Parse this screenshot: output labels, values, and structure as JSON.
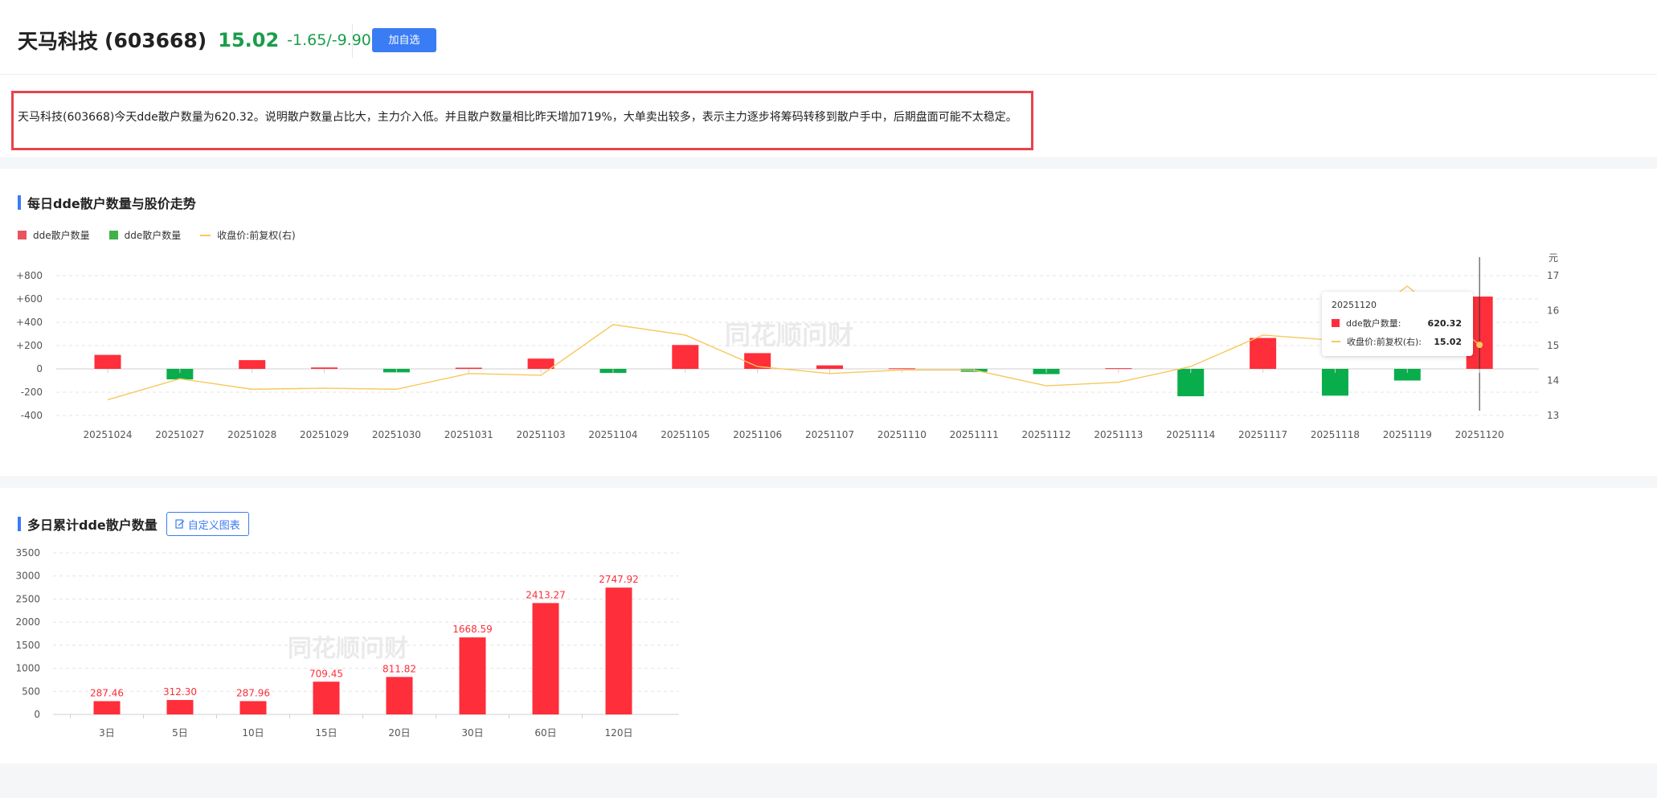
{
  "header": {
    "name": "天马科技",
    "code": "(603668)",
    "price": "15.02",
    "change": "-1.65/-9.90%",
    "add_label": "加自选"
  },
  "summary": {
    "text": "天马科技(603668)今天dde散户数量为620.32。说明散户数量占比大，主力介入低。并且散户数量相比昨天增加719%，大单卖出较多，表示主力逐步将筹码转移到散户手中，后期盘面可能不太稳定。"
  },
  "section1": {
    "title": "每日dde散户数量与股价走势",
    "legend": [
      "dde散户数量",
      "dde散户数量",
      "收盘价:前复权(右)"
    ],
    "unit_right": "元",
    "watermark": "同花顺问财"
  },
  "tooltip": {
    "date": "20251120",
    "label1": "dde散户数量:",
    "value1": "620.32",
    "label2": "收盘价:前复权(右):",
    "value2": "15.02"
  },
  "section2": {
    "title": "多日累计dde散户数量",
    "custom_label": "自定义图表",
    "watermark": "同花顺问财"
  },
  "colors": {
    "up": "#fe2e3a",
    "down": "#0aad4b",
    "price_line": "#f7c85b",
    "accent": "#3a7cf4"
  },
  "chart_data": [
    {
      "type": "bar",
      "categories": [
        "20251024",
        "20251027",
        "20251028",
        "20251029",
        "20251030",
        "20251031",
        "20251103",
        "20251104",
        "20251105",
        "20251106",
        "20251107",
        "20251110",
        "20251111",
        "20251112",
        "20251113",
        "20251114",
        "20251117",
        "20251118",
        "20251119",
        "20251120"
      ],
      "series": [
        {
          "name": "dde散户数量",
          "values": [
            120,
            -90,
            75,
            12,
            -30,
            10,
            88,
            -35,
            205,
            135,
            30,
            5,
            -25,
            -45,
            6,
            -235,
            265,
            -230,
            -100,
            620.32
          ]
        },
        {
          "name": "收盘价:前复权(右)",
          "type": "line",
          "axis": "right",
          "values": [
            13.45,
            14.05,
            13.75,
            13.78,
            13.75,
            14.2,
            14.15,
            15.6,
            15.3,
            14.4,
            14.2,
            14.3,
            14.3,
            13.85,
            13.95,
            14.4,
            15.3,
            15.15,
            16.7,
            15.02
          ]
        }
      ],
      "ylim": [
        -400,
        800
      ],
      "yticks": [
        "+800",
        "+600",
        "+400",
        "+200",
        "0",
        "-200",
        "-400"
      ],
      "y2lim": [
        13,
        17
      ],
      "y2ticks": [
        "17",
        "16",
        "15",
        "14",
        "13"
      ],
      "y2label": "元",
      "grid": true,
      "legend_position": "top-left"
    },
    {
      "type": "bar",
      "categories": [
        "3日",
        "5日",
        "10日",
        "15日",
        "20日",
        "30日",
        "60日",
        "120日"
      ],
      "values": [
        287.46,
        312.3,
        287.96,
        709.45,
        811.82,
        1668.59,
        2413.27,
        2747.92
      ],
      "labels": [
        "287.46",
        "312.30",
        "287.96",
        "709.45",
        "811.82",
        "1668.59",
        "2413.27",
        "2747.92"
      ],
      "ylim": [
        0,
        3500
      ],
      "yticks": [
        "3500",
        "3000",
        "2500",
        "2000",
        "1500",
        "1000",
        "500",
        "0"
      ],
      "grid": true
    }
  ]
}
